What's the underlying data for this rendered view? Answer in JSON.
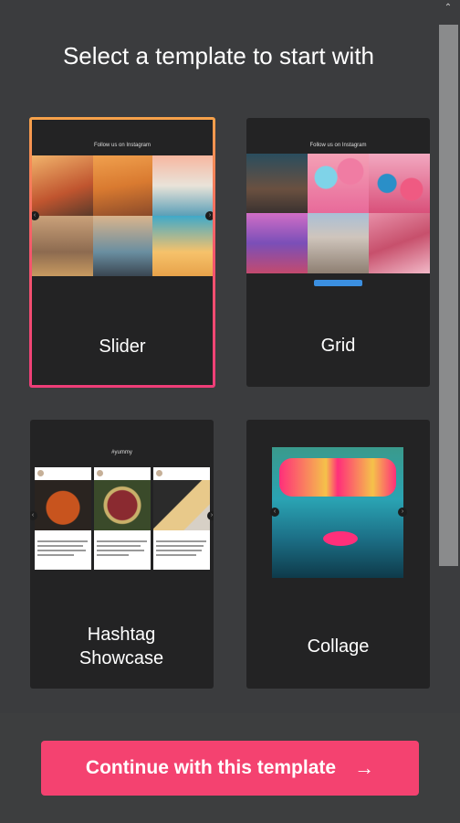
{
  "header": {
    "title": "Select a template to start with"
  },
  "templates": [
    {
      "label": "Slider",
      "selected": true,
      "preview_heading": "Follow us on Instagram"
    },
    {
      "label": "Grid",
      "selected": false,
      "preview_heading": "Follow us on Instagram"
    },
    {
      "label": "Hashtag Showcase",
      "selected": false,
      "preview_heading": "#yummy"
    },
    {
      "label": "Collage",
      "selected": false,
      "preview_heading": ""
    }
  ],
  "footer": {
    "continue_label": "Continue with this template",
    "continue_icon": "arrow-right-icon"
  },
  "colors": {
    "accent": "#f44270",
    "card_bg": "#232324",
    "page_bg": "#3b3c3e"
  }
}
